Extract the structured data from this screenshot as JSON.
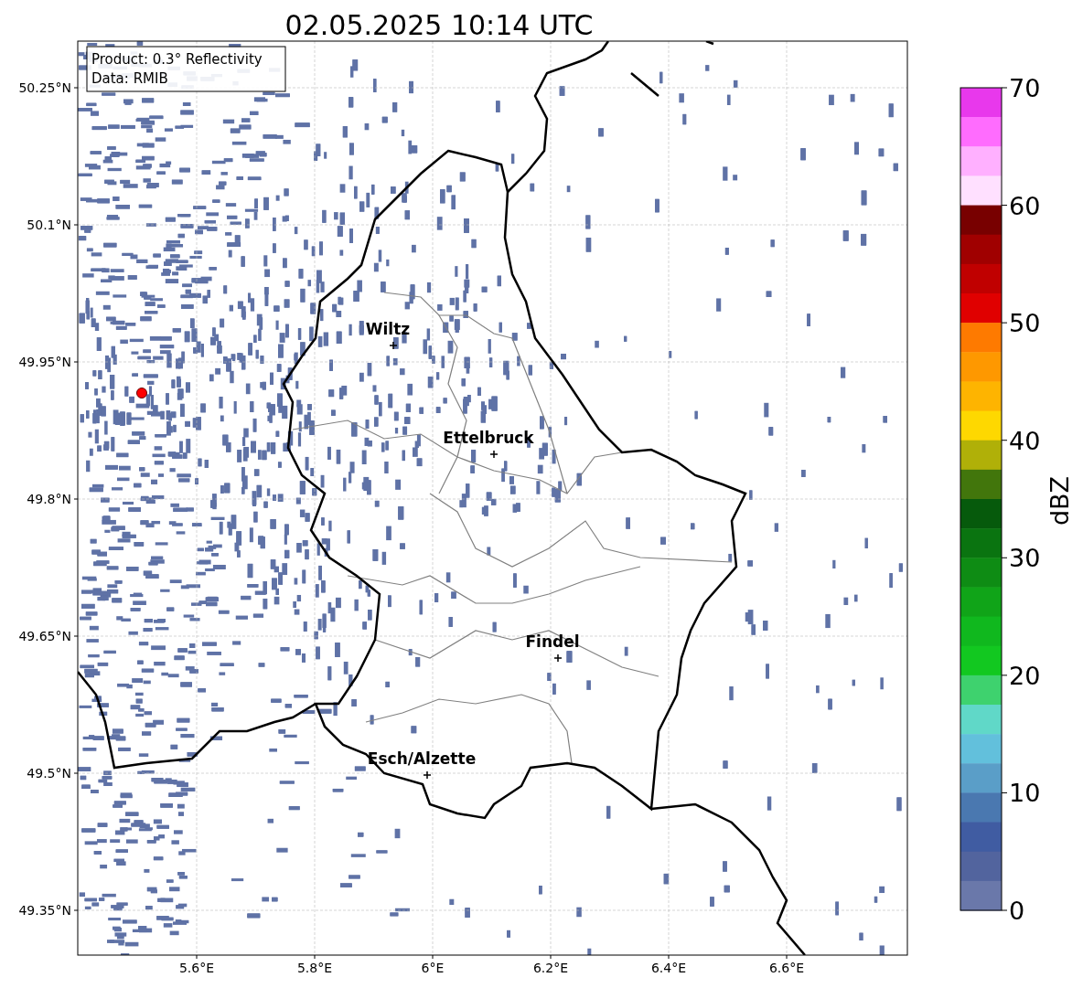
{
  "title": "02.05.2025 10:14 UTC",
  "annotation": [
    "Product: 0.3° Reflectivity",
    "Data: RMIB"
  ],
  "map": {
    "lat_ticks": [
      "50.25°N",
      "50.1°N",
      "49.95°N",
      "49.8°N",
      "49.65°N",
      "49.5°N",
      "49.35°N"
    ],
    "lon_ticks": [
      "5.6°E",
      "5.8°E",
      "6°E",
      "6.2°E",
      "6.4°E",
      "6.6°E"
    ],
    "cities": [
      {
        "name": "Wiltz"
      },
      {
        "name": "Ettelbruck"
      },
      {
        "name": "Findel"
      },
      {
        "name": "Esch/Alzette"
      }
    ]
  },
  "colorbar": {
    "label": "dBZ",
    "ticks": [
      "70",
      "60",
      "50",
      "40",
      "30",
      "20",
      "10",
      "0"
    ],
    "segments": [
      {
        "color": "#e838ec"
      },
      {
        "color": "#ff6cfe"
      },
      {
        "color": "#ffb0ff"
      },
      {
        "color": "#ffe0ff"
      },
      {
        "color": "#780000"
      },
      {
        "color": "#a00000"
      },
      {
        "color": "#c00000"
      },
      {
        "color": "#e00000"
      },
      {
        "color": "#fe7a00"
      },
      {
        "color": "#fe9800"
      },
      {
        "color": "#feb400"
      },
      {
        "color": "#fed800"
      },
      {
        "color": "#b0b008"
      },
      {
        "color": "#42760c"
      },
      {
        "color": "#065a0c"
      },
      {
        "color": "#0a7410"
      },
      {
        "color": "#0e8c14"
      },
      {
        "color": "#10a418"
      },
      {
        "color": "#10b81e"
      },
      {
        "color": "#12c820"
      },
      {
        "color": "#3ed26e"
      },
      {
        "color": "#60d8c8"
      },
      {
        "color": "#62c0dc"
      },
      {
        "color": "#5a9ec8"
      },
      {
        "color": "#4a78b0"
      },
      {
        "color": "#405ca2"
      },
      {
        "color": "#52649e"
      },
      {
        "color": "#6a78aa"
      }
    ]
  }
}
